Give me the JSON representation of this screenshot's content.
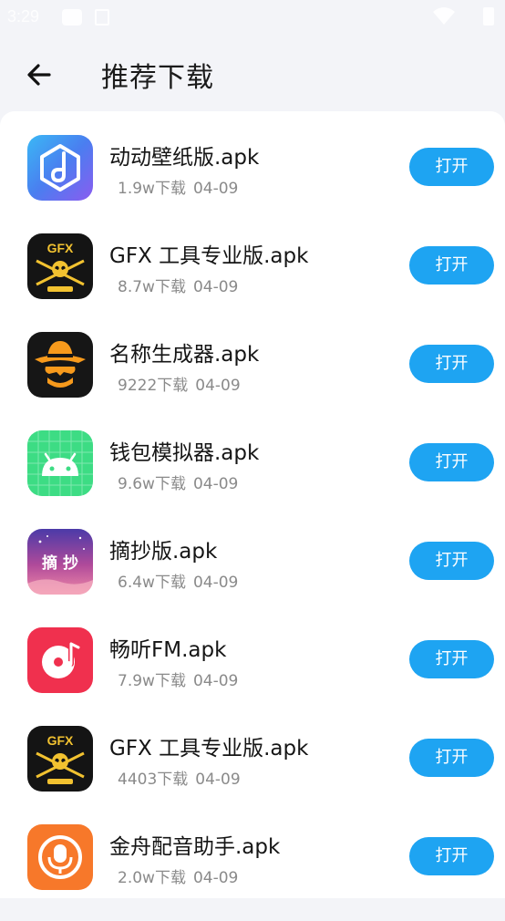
{
  "status_bar": {
    "time": "3:29"
  },
  "header": {
    "title": "推荐下载",
    "back_icon": "arrow-left-icon"
  },
  "apps": [
    {
      "name": "动动壁纸版.apk",
      "downloads": "1.9w下载",
      "date": "04-09",
      "button": "打开",
      "icon": "wallpaper-app-icon"
    },
    {
      "name": "GFX 工具专业版.apk",
      "downloads": "8.7w下载",
      "date": "04-09",
      "button": "打开",
      "icon": "gfx-tool-app-icon",
      "icon_text": "GFX"
    },
    {
      "name": "名称生成器.apk",
      "downloads": "9222下载",
      "date": "04-09",
      "button": "打开",
      "icon": "cowboy-app-icon"
    },
    {
      "name": "钱包模拟器.apk",
      "downloads": "9.6w下载",
      "date": "04-09",
      "button": "打开",
      "icon": "android-app-icon"
    },
    {
      "name": "摘抄版.apk",
      "downloads": "6.4w下载",
      "date": "04-09",
      "button": "打开",
      "icon": "excerpt-app-icon",
      "icon_text": "摘 抄"
    },
    {
      "name": "畅听FM.apk",
      "downloads": "7.9w下载",
      "date": "04-09",
      "button": "打开",
      "icon": "music-fm-app-icon"
    },
    {
      "name": "GFX 工具专业版.apk",
      "downloads": "4403下载",
      "date": "04-09",
      "button": "打开",
      "icon": "gfx-tool-app-icon",
      "icon_text": "GFX"
    },
    {
      "name": "金舟配音助手.apk",
      "downloads": "2.0w下载",
      "date": "04-09",
      "button": "打开",
      "icon": "dubbing-app-icon"
    }
  ],
  "colors": {
    "accent": "#1ea4f2",
    "background": "#f3f4f8",
    "card": "#ffffff"
  }
}
